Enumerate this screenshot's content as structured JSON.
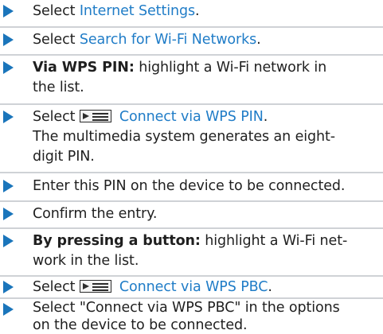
{
  "steps": [
    {
      "prefix": "Select ",
      "link": "Internet Settings",
      "suffix": "."
    },
    {
      "prefix": "Select ",
      "link": "Search for Wi-Fi Networks",
      "suffix": "."
    },
    {
      "bold": "Via WPS PIN:",
      "line1": " highlight a Wi-Fi network in",
      "line2": "the list."
    },
    {
      "prefix": "Select ",
      "icon": "menu-icon",
      "link": "Connect via WPS PIN",
      "suffix": ".",
      "line2": "The multimedia system generates an eight-",
      "line3": "digit PIN."
    },
    {
      "text": "Enter this PIN on the device to be connected."
    },
    {
      "text": "Confirm the entry."
    },
    {
      "bold": "By pressing a button:",
      "line1": " highlight a Wi-Fi net-",
      "line2": "work in the list."
    },
    {
      "prefix": "Select ",
      "icon": "menu-icon",
      "link": "Connect via WPS PBC",
      "suffix": "."
    },
    {
      "line1": "Select \"Connect via WPS PBC\" in the options",
      "line2": "on the device to be connected."
    }
  ],
  "colors": {
    "arrow": "#1a75bb",
    "link": "#1f7cc7",
    "divider": "#cfd2d6",
    "text": "#1f1f1f"
  }
}
